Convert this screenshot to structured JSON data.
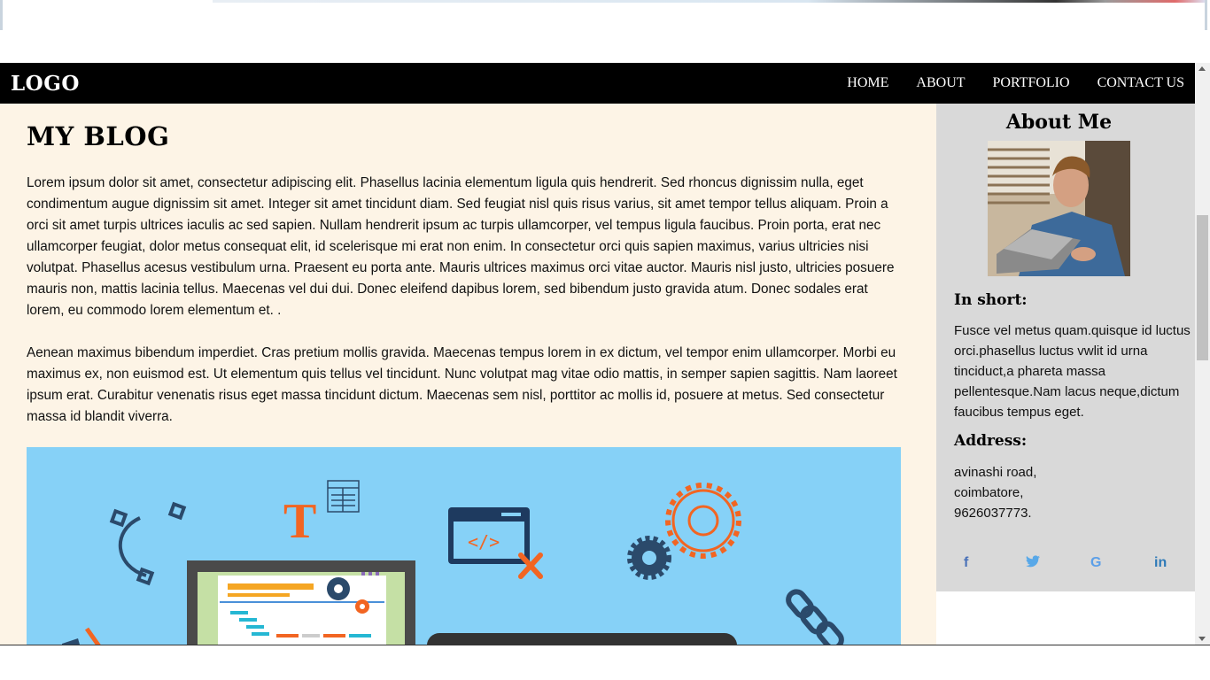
{
  "nav": {
    "logo": "LOGO",
    "items": [
      "HOME",
      "ABOUT",
      "PORTFOLIO",
      "CONTACT US"
    ]
  },
  "main": {
    "title": "MY BLOG",
    "paragraphs": [
      "Lorem ipsum dolor sit amet, consectetur adipiscing elit. Phasellus lacinia elementum ligula quis hendrerit. Sed rhoncus dignissim nulla, eget condimentum augue dignissim sit amet. Integer sit amet tincidunt diam. Sed feugiat nisl quis risus varius, sit amet tempor tellus aliquam. Proin a orci sit amet turpis ultrices iaculis ac sed sapien. Nullam hendrerit ipsum ac turpis ullamcorper, vel tempus ligula faucibus. Proin porta, erat nec ullamcorper feugiat, dolor metus consequat elit, id scelerisque mi erat non enim. In consectetur orci quis sapien maximus, varius ultricies nisi volutpat. Phasellus acesus vestibulum urna. Praesent eu porta ante. Mauris ultrices maximus orci vitae auctor. Mauris nisl justo, ultricies posuere mauris non, mattis lacinia tellus. Maecenas vel dui dui. Donec eleifend dapibus lorem, sed bibendum justo gravida atum. Donec sodales erat lorem, eu commodo lorem elementum et. .",
      "Aenean maximus bibendum imperdiet. Cras pretium mollis gravida. Maecenas tempus lorem in ex dictum, vel tempor enim ullamcorper. Morbi eu maximus ex, non euismod est. Ut elementum quis tellus vel tincidunt. Nunc volutpat mag vitae odio mattis, in semper sapien sagittis. Nam laoreet ipsum erat. Curabitur venenatis risus eget massa tincidunt dictum. Maecenas sem nisl, porttitor ac mollis id, posuere at metus. Sed consectetur massa id blandit viverra."
    ],
    "hero_text": {
      "letter": "T",
      "code": "</>"
    }
  },
  "sidebar": {
    "title": "About Me",
    "short_heading": "In short:",
    "short_text": "Fusce vel metus quam.quisque id luctus orci.phasellus luctus vwlit id urna tinciduct,a phareta massa pellentesque.Nam lacus neque,dictum faucibus tempus eget.",
    "address_heading": "Address:",
    "address_lines": [
      "avinashi road,",
      "coimbatore,",
      "9626037773."
    ],
    "social": {
      "facebook": "f",
      "twitter": "🐦",
      "google": "G",
      "linkedin": "in"
    }
  },
  "colors": {
    "navbar": "#000000",
    "main_bg": "#fdf4e6",
    "sidebar_bg": "#d9d9d9",
    "hero_bg": "#86d1f7",
    "accent_orange": "#f26522",
    "icon_navy": "#2b4a6b"
  }
}
